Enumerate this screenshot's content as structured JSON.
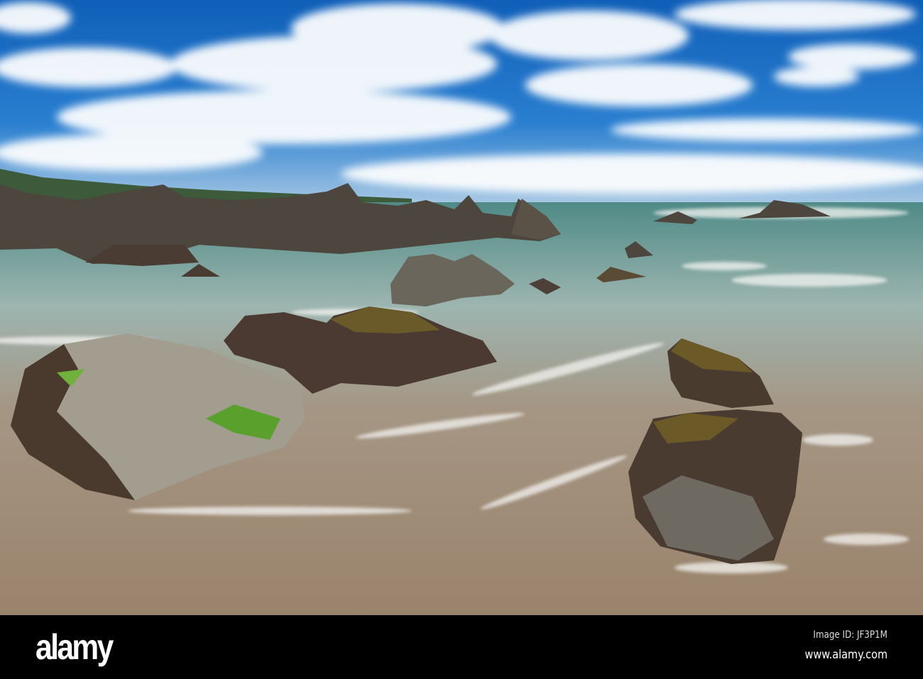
{
  "photo": {
    "subject": "rocky beach",
    "colors": {
      "sky": "#1d6fc4",
      "sea": "#7fa6a4",
      "sand": "#9a8774",
      "rock": "#4a3d33",
      "algae": "#5aa02c"
    }
  },
  "footer": {
    "logo": "alamy",
    "image_id": "Image ID: JF3P1M",
    "website": "www.alamy.com"
  }
}
